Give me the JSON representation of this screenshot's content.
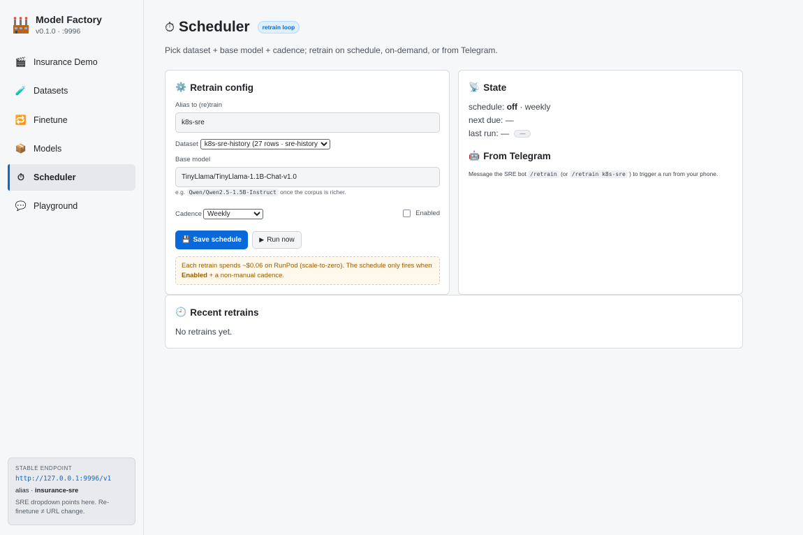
{
  "app": {
    "title": "Model Factory",
    "version": "v0.1.0 · :9996"
  },
  "nav": [
    {
      "label": "Insurance Demo",
      "icon": "clapper-icon"
    },
    {
      "label": "Datasets",
      "icon": "test-tube-icon"
    },
    {
      "label": "Finetune",
      "icon": "cycle-icon"
    },
    {
      "label": "Models",
      "icon": "package-icon"
    },
    {
      "label": "Scheduler",
      "icon": "stopwatch-icon",
      "active": true
    },
    {
      "label": "Playground",
      "icon": "speech-bubble-icon"
    }
  ],
  "endpoint": {
    "label": "STABLE ENDPOINT",
    "url": "http://127.0.0.1:9996/v1",
    "alias_prefix": "alias · ",
    "alias_name": "insurance-sre",
    "note": "SRE dropdown points here. Re-finetune ≠ URL change."
  },
  "page": {
    "title": "Scheduler",
    "badge": "retrain loop",
    "subtitle": "Pick dataset + base model + cadence; retrain on schedule, on-demand, or from Telegram."
  },
  "config": {
    "heading": "Retrain config",
    "alias_label": "Alias to (re)train",
    "alias_value": "k8s-sre",
    "dataset_label": "Dataset",
    "dataset_value": "k8s-sre-history (27 rows · sre-history)",
    "base_label": "Base model",
    "base_value": "TinyLlama/TinyLlama-1.1B-Chat-v1.0",
    "hint_prefix": "e.g.",
    "hint_code": "Qwen/Qwen2.5-1.5B-Instruct",
    "hint_suffix": "once the corpus is richer.",
    "cadence_label": "Cadence",
    "cadence_value": "Weekly",
    "enabled_label": "Enabled",
    "enabled": false,
    "save_label": "Save schedule",
    "run_label": "Run now",
    "warn_1": "Each retrain spends ~$0.06 on RunPod (scale-to-zero). The schedule only fires when",
    "warn_bold": "Enabled",
    "warn_2": "+ a non-manual cadence."
  },
  "state": {
    "heading": "State",
    "schedule_label": "schedule:",
    "schedule_status": "off",
    "schedule_rest": "· weekly",
    "next_due": "next due: —",
    "last_run": "last run: —",
    "last_run_pill": "—"
  },
  "telegram": {
    "heading": "From Telegram",
    "msg_1": "Message the SRE bot",
    "cmd_1": "/retrain",
    "msg_2": "(or",
    "cmd_2": "/retrain k8s-sre",
    "msg_3": ") to trigger a run from your phone."
  },
  "recent": {
    "heading": "Recent retrains",
    "empty": "No retrains yet."
  },
  "colors": {
    "accent": "#0969da",
    "warn_bg": "#fff8ec",
    "warn_text": "#9a5b00"
  }
}
